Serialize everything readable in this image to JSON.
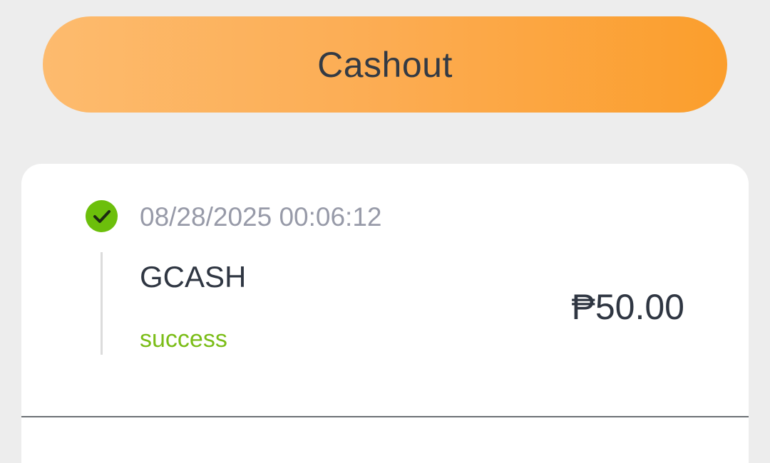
{
  "header": {
    "cashout_label": "Cashout"
  },
  "transaction": {
    "status_icon": "check-circle-icon",
    "timestamp": "08/28/2025 00:06:12",
    "channel": "GCASH",
    "status": "success",
    "amount": "₱50.00"
  },
  "colors": {
    "button_gradient_start": "#fdbb6e",
    "button_gradient_end": "#fb9e2c",
    "success_green": "#7bbd18",
    "check_icon_green": "#6cbf0b",
    "background": "#ededed",
    "card_background": "#ffffff"
  }
}
